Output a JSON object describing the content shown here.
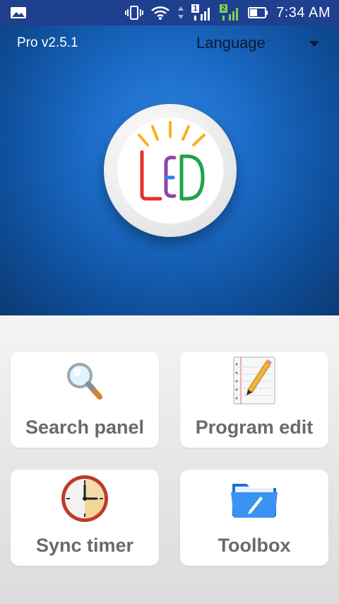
{
  "status_bar": {
    "time": "7:34 AM",
    "sim1_label": "1",
    "sim2_label": "2",
    "icons": [
      "image-icon",
      "vibrate-icon",
      "wifi-icon",
      "data-arrows-icon",
      "signal-sim1-icon",
      "signal-sim2-icon",
      "battery-icon"
    ]
  },
  "header": {
    "version": "Pro v2.5.1",
    "language_label": "Language"
  },
  "logo": {
    "icon": "led-logo",
    "text": "LED"
  },
  "menu": {
    "items": [
      {
        "label": "Search panel",
        "icon": "magnifier-icon"
      },
      {
        "label": "Program edit",
        "icon": "notepad-pencil-icon"
      },
      {
        "label": "Sync timer",
        "icon": "clock-icon"
      },
      {
        "label": "Toolbox",
        "icon": "folder-icon"
      }
    ]
  },
  "colors": {
    "status_bar": "#1f3f8f",
    "hero_center": "#2e86e0",
    "hero_edge": "#0b3a74",
    "card_label": "#6a6a6a"
  }
}
